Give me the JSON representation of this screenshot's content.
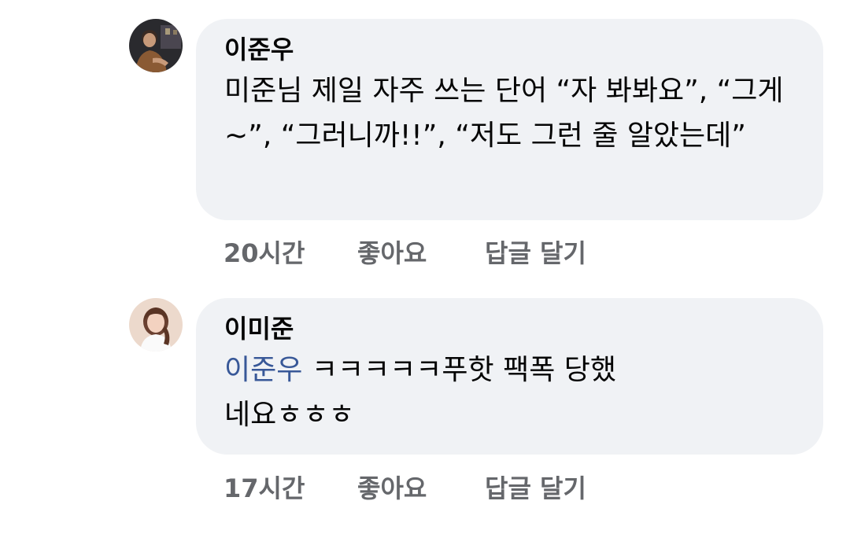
{
  "comments": [
    {
      "author": "이준우",
      "avatar_icon": "user-avatar-icon",
      "text": "미준님 제일 자주 쓰는 단어 “자 봐봐요”, “그게~”, “그러니까!!”, “저도 그런 줄 알았는데”",
      "time": "20시간",
      "like_label": "좋아요",
      "reply_label": "답글 달기"
    },
    {
      "author": "이미준",
      "avatar_icon": "user-avatar-icon",
      "mention": "이준우",
      "text": " ㅋㅋㅋㅋㅋ푸핫 팩폭 당했네요ㅎㅎㅎ",
      "time": "17시간",
      "like_label": "좋아요",
      "reply_label": "답글 달기"
    }
  ],
  "colors": {
    "bubble_bg": "#f0f2f5",
    "mention": "#385898",
    "meta": "#65676b"
  }
}
